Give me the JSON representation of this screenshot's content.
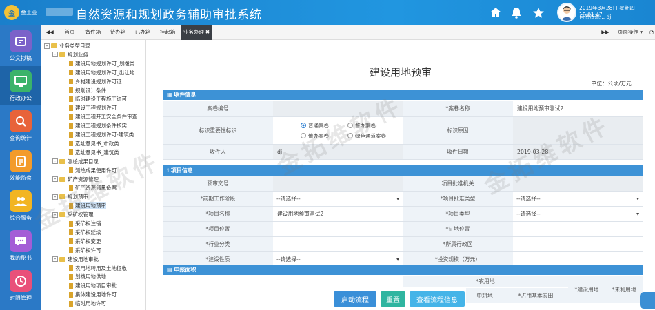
{
  "header": {
    "logo_text": "金",
    "logo_sub": "金土业",
    "title": "自然资源和规划政务辅助审批系统",
    "datetime": "2019年3月28日 星期四 18:01:47",
    "user_line": "自然资源... dj",
    "icons": [
      "home-icon",
      "bell-icon",
      "star-icon"
    ]
  },
  "nav": {
    "items": [
      {
        "label": "公文拟稿",
        "color": "#7b62c9"
      },
      {
        "label": "行政办公",
        "color": "#3bb36a"
      },
      {
        "label": "查询统计",
        "color": "#e8633a"
      },
      {
        "label": "效能监察",
        "color": "#f39b2a"
      },
      {
        "label": "综合服务",
        "color": "#f2b522"
      },
      {
        "label": "我的秘书",
        "color": "#a45dd6"
      },
      {
        "label": "时限管理",
        "color": "#e9507a"
      }
    ]
  },
  "tabs": {
    "items": [
      "首页",
      "备件箱",
      "待办箱",
      "已办箱",
      "挂起箱",
      "业务办理"
    ],
    "page_ops": "页面操作"
  },
  "tree": {
    "nodes": [
      {
        "t": "业务类型目录",
        "lvl": 0,
        "kind": "folder",
        "pm": "-"
      },
      {
        "t": "规划业务",
        "lvl": 1,
        "kind": "folder",
        "pm": "-"
      },
      {
        "t": "建设用地规划许可_划拨类",
        "lvl": 2,
        "kind": "doc"
      },
      {
        "t": "建设用地规划许可_出让地",
        "lvl": 2,
        "kind": "doc"
      },
      {
        "t": "乡村建设规划许可证",
        "lvl": 2,
        "kind": "doc"
      },
      {
        "t": "规划设计条件",
        "lvl": 2,
        "kind": "doc"
      },
      {
        "t": "临时建设工程施工许可",
        "lvl": 2,
        "kind": "doc"
      },
      {
        "t": "建设工程规划许可",
        "lvl": 2,
        "kind": "doc"
      },
      {
        "t": "建设工程开工安全条件审查",
        "lvl": 2,
        "kind": "doc"
      },
      {
        "t": "建设工程规划条件核实",
        "lvl": 2,
        "kind": "doc"
      },
      {
        "t": "建设工程规划许可-建筑类",
        "lvl": 2,
        "kind": "doc"
      },
      {
        "t": "选址意见书_市政类",
        "lvl": 2,
        "kind": "doc"
      },
      {
        "t": "选址意见书_建筑类",
        "lvl": 2,
        "kind": "doc"
      },
      {
        "t": "测绘成果目录",
        "lvl": 1,
        "kind": "folder",
        "pm": "-"
      },
      {
        "t": "测绘成果使用许可",
        "lvl": 2,
        "kind": "doc"
      },
      {
        "t": "矿产资源管理",
        "lvl": 1,
        "kind": "folder",
        "pm": "-"
      },
      {
        "t": "矿产资源储量备案",
        "lvl": 2,
        "kind": "doc"
      },
      {
        "t": "规划预审",
        "lvl": 1,
        "kind": "folder",
        "pm": "-"
      },
      {
        "t": "建设用地预审",
        "lvl": 2,
        "kind": "doc",
        "sel": true
      },
      {
        "t": "采矿权管理",
        "lvl": 1,
        "kind": "folder",
        "pm": "-"
      },
      {
        "t": "采矿权注销",
        "lvl": 2,
        "kind": "doc"
      },
      {
        "t": "采矿权延续",
        "lvl": 2,
        "kind": "doc"
      },
      {
        "t": "采矿权变更",
        "lvl": 2,
        "kind": "doc"
      },
      {
        "t": "采矿权许可",
        "lvl": 2,
        "kind": "doc"
      },
      {
        "t": "建设用地审批",
        "lvl": 1,
        "kind": "folder",
        "pm": "-"
      },
      {
        "t": "农用地转用及土地征收",
        "lvl": 2,
        "kind": "doc"
      },
      {
        "t": "划拨用地供地",
        "lvl": 2,
        "kind": "doc"
      },
      {
        "t": "建设用地项目审批",
        "lvl": 2,
        "kind": "doc"
      },
      {
        "t": "集体建设用地许可",
        "lvl": 2,
        "kind": "doc"
      },
      {
        "t": "临时用地许可",
        "lvl": 2,
        "kind": "doc"
      }
    ]
  },
  "form": {
    "title": "建设用地预审",
    "unit": "单位：公顷/万元",
    "sections": {
      "receive": "收件信息",
      "project": "项目信息",
      "apply": "申报面积"
    },
    "receive": {
      "case_no_label": "案卷编号",
      "case_name_label": "*案卷名称",
      "case_name_value": "建设用地预审测试2",
      "mark_label": "标识重要性标识",
      "radios": [
        "普通案卷",
        "督办案卷",
        "催办案卷",
        "绿色通道案卷"
      ],
      "mark_reason_label": "标识原因",
      "receiver_label": "收件人",
      "receiver_value": "dj",
      "receive_date_label": "收件日期",
      "receive_date_value": "2019-03-28"
    },
    "project": {
      "pre_doc_label": "预审文号",
      "approval_org_label": "项目批准机关",
      "stage_label": "*前期工作阶段",
      "approval_type_label": "*项目批准类型",
      "select_placeholder": "--请选择--",
      "name_label": "*项目名称",
      "name_value": "建设用地预审测试2",
      "type_label": "*项目类型",
      "position_label": "*项目位置",
      "land_position_label": "*征地位置",
      "industry_label": "*行业分类",
      "admin_region_label": "*所属行政区",
      "nature_label": "*建设性质",
      "invest_label": "*投资规模（万元）"
    },
    "apply_headers": [
      "*农用地",
      "中耕地",
      "*占用基本农田",
      "*建设用地",
      "*未利用地"
    ]
  },
  "buttons": {
    "start": "启动流程",
    "reset": "重置",
    "view": "查看流程信息"
  },
  "watermark": "金拓维软件"
}
